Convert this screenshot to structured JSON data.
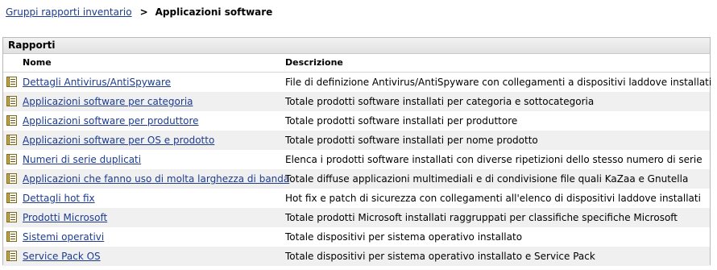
{
  "breadcrumb": {
    "parent": "Gruppi rapporti inventario",
    "separator": ">",
    "current": "Applicazioni software"
  },
  "panel": {
    "title": "Rapporti",
    "columns": {
      "name": "Nome",
      "description": "Descrizione"
    },
    "rows": [
      {
        "name": "Dettagli Antivirus/AntiSpyware",
        "description": "File di definizione Antivirus/AntiSpyware con collegamenti a dispositivi laddove installati",
        "icon": "report-icon"
      },
      {
        "name": "Applicazioni software per categoria",
        "description": "Totale prodotti software installati per categoria e sottocategoria",
        "icon": "report-icon"
      },
      {
        "name": "Applicazioni software per produttore",
        "description": "Totale prodotti software installati per produttore",
        "icon": "report-icon"
      },
      {
        "name": "Applicazioni software per OS e prodotto",
        "description": "Totale prodotti software installati per nome prodotto",
        "icon": "report-icon"
      },
      {
        "name": "Numeri di serie duplicati",
        "description": "Elenca i prodotti software installati con diverse ripetizioni dello stesso numero di serie",
        "icon": "report-icon"
      },
      {
        "name": "Applicazioni che fanno uso di molta larghezza di banda",
        "description": "Totale diffuse applicazioni multimediali e di condivisione file quali KaZaa e Gnutella",
        "icon": "report-icon"
      },
      {
        "name": "Dettagli hot fix",
        "description": "Hot fix e patch di sicurezza con collegamenti all'elenco di dispositivi laddove installati",
        "icon": "report-icon"
      },
      {
        "name": "Prodotti Microsoft",
        "description": "Totale prodotti Microsoft installati raggruppati per classifiche specifiche Microsoft",
        "icon": "report-icon"
      },
      {
        "name": "Sistemi operativi",
        "description": "Totale dispositivi per sistema operativo installato",
        "icon": "report-icon"
      },
      {
        "name": "Service Pack OS",
        "description": "Totale dispositivi per sistema operativo installato e Service Pack",
        "icon": "report-icon"
      }
    ]
  },
  "colors": {
    "link": "#1d3c8f",
    "alt_row": "#f0f0f0",
    "header_bg": "#e6e6e6",
    "border": "#b9b9b9"
  }
}
